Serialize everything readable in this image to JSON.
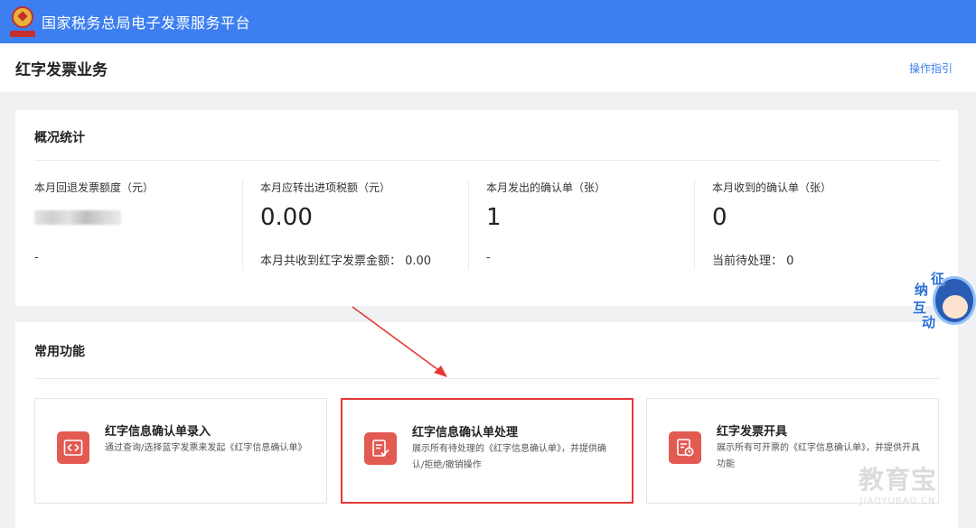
{
  "topbar": {
    "title": "国家税务总局电子发票服务平台"
  },
  "header": {
    "title": "红字发票业务",
    "guide_link": "操作指引"
  },
  "overview": {
    "title": "概况统计",
    "stats": [
      {
        "label": "本月回退发票额度（元）",
        "value": "",
        "sub": "-"
      },
      {
        "label": "本月应转出进项税额（元）",
        "value": "0.00",
        "sub": "本月共收到红字发票金额：  0.00"
      },
      {
        "label": "本月发出的确认单（张）",
        "value": "1",
        "sub": "-"
      },
      {
        "label": "本月收到的确认单（张）",
        "value": "0",
        "sub": "当前待处理：  0"
      }
    ]
  },
  "functions": {
    "title": "常用功能",
    "items": [
      {
        "title": "红字信息确认单录入",
        "desc": "通过查询/选择蓝字发票来发起《红字信息确认单》",
        "icon": "swap-arrows-icon"
      },
      {
        "title": "红字信息确认单处理",
        "desc": "展示所有待处理的《红字信息确认单》，并提供确认/拒绝/撤销操作",
        "icon": "document-check-icon",
        "highlighted": true
      },
      {
        "title": "红字发票开具",
        "desc": "展示所有可开票的《红字信息确认单》，并提供开具功能",
        "icon": "invoice-clock-icon"
      }
    ]
  },
  "mascot": {
    "chars": [
      "征",
      "纳",
      "互",
      "动"
    ]
  },
  "watermark": {
    "big": "教育宝",
    "small": "JIAOYUBAO.CN"
  },
  "colors": {
    "topbar": "#3d7ff0",
    "accent": "#3d7ff0",
    "icon_bg": "#e25a52",
    "highlight": "#e53935"
  }
}
